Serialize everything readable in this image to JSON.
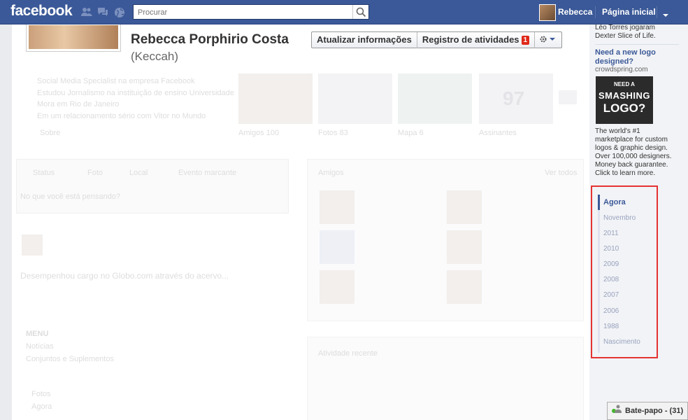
{
  "topbar": {
    "logo": "facebook",
    "search_placeholder": "Procurar",
    "user_name": "Rebecca",
    "home_label": "Página inicial"
  },
  "profile": {
    "name": "Rebecca Porphirio Costa",
    "nickname": "(Keccah)",
    "update_button": "Atualizar informações",
    "activity_button": "Registro de atividades",
    "activity_count": "1"
  },
  "faded": {
    "about_lines": [
      "Social Media Specialist na empresa Facebook",
      "Estudou Jornalismo na instituição de ensino Universidade",
      "Mora em Rio de Janeiro",
      "Em um relacionamento sério com Vitor no Mundo"
    ],
    "tiles": [
      "Sobre",
      "Amigos 100",
      "Fotos 83",
      "Mapa 6",
      "Assinantes"
    ],
    "tile_number": "97",
    "composer": [
      "Status",
      "Foto",
      "Local",
      "Evento marcante"
    ],
    "composer_placeholder": "No que você está pensando?",
    "friends_title": "Amigos",
    "friends_see_all": "Ver todos",
    "recent_title": "Atividade recente",
    "menu_title": "MENU",
    "menu_items": [
      "Notícias",
      "Conjuntos e Suplementos",
      "Fotos",
      "Agora"
    ],
    "desc_text": "Desempenhou cargo no Globo.com através do acervo..."
  },
  "sidebar": {
    "ad_top_lines": [
      "Léo Torres jogaram",
      "Dexter Slice of Life."
    ],
    "ad_title": "Need a new logo designed?",
    "ad_domain": "crowdspring.com",
    "ad_image_text": [
      "NEED A",
      "SMASHING",
      "LOGO?"
    ],
    "ad_body": [
      "The world's #1",
      "marketplace for custom",
      "logos & graphic design.",
      "Over 100,000 designers.",
      "Money back guarantee.",
      "Click to learn more."
    ]
  },
  "timeline": {
    "items": [
      "Agora",
      "Novembro",
      "2011",
      "2010",
      "2009",
      "2008",
      "2007",
      "2006",
      "1988",
      "Nascimento"
    ]
  },
  "chat": {
    "label": "Bate-papo - (31)"
  },
  "colors": {
    "brand": "#3b5998",
    "highlight_border": "#e53232"
  }
}
